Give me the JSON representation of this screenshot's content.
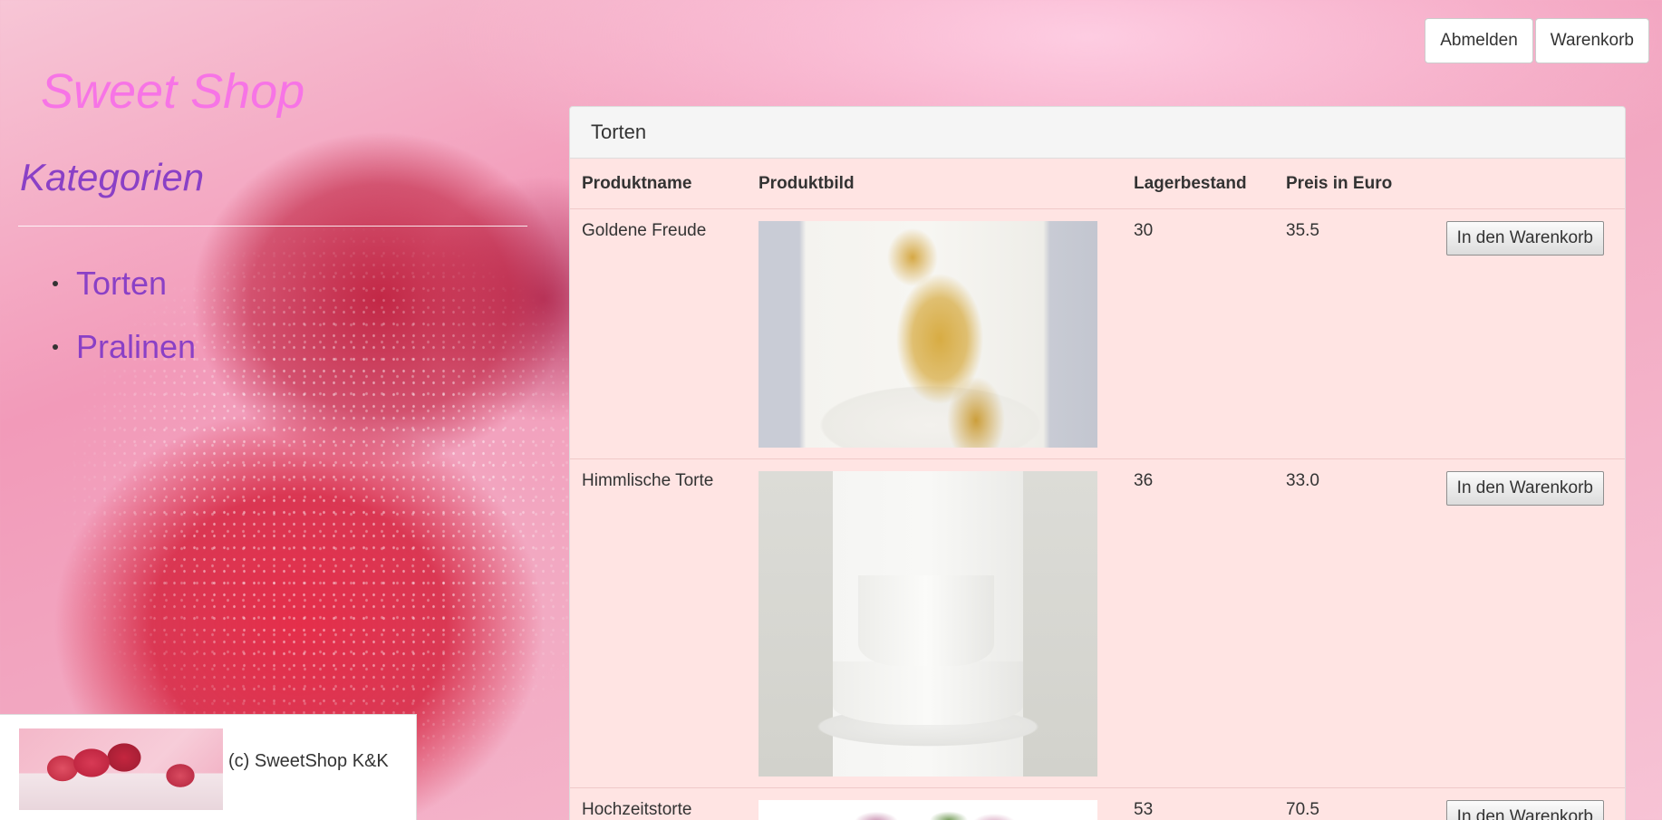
{
  "brand": "Sweet Shop",
  "header": {
    "logout_label": "Abmelden",
    "cart_label": "Warenkorb"
  },
  "sidebar": {
    "title": "Kategorien",
    "items": [
      {
        "label": "Torten"
      },
      {
        "label": "Pralinen"
      }
    ]
  },
  "footer": {
    "text": "(c) SweetShop K&K"
  },
  "panel": {
    "title": "Torten",
    "columns": {
      "name": "Produktname",
      "image": "Produktbild",
      "stock": "Lagerbestand",
      "price": "Preis in Euro"
    },
    "add_to_cart_label": "In den Warenkorb",
    "products": [
      {
        "name": "Goldene Freude",
        "stock": "30",
        "price": "35.5"
      },
      {
        "name": "Himmlische Torte",
        "stock": "36",
        "price": "33.0"
      },
      {
        "name": "Hochzeitstorte",
        "stock": "53",
        "price": "70.5"
      }
    ]
  },
  "colors": {
    "brand": "#f774e6",
    "category": "#8a40c6",
    "panel_background": "#ffe4e3"
  }
}
